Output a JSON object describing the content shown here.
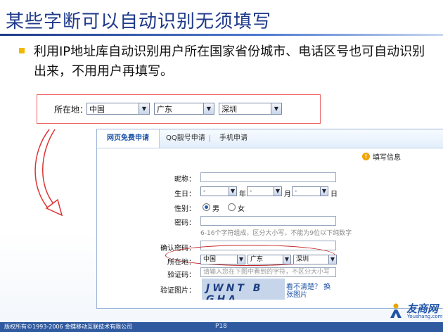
{
  "slide": {
    "title": "某些字断可以自动识别无须填写",
    "bullet": "利用IP地址库自动识别用户所在国家省份城市、电话区号也可自动识别出来，不用用户再填写。"
  },
  "region_box": {
    "label": "所在地：",
    "country": "中国",
    "province": "广东",
    "city": "深圳"
  },
  "form": {
    "tabs": [
      "网页免费申请",
      "QQ靓号申请",
      "手机申请"
    ],
    "info_label": "填写信息",
    "nickname_label": "昵称：",
    "birthday_label": "生日：",
    "birthday_year": "-",
    "birthday_year_unit": "年",
    "birthday_month": "-",
    "birthday_month_unit": "月",
    "birthday_day": "-",
    "birthday_day_unit": "日",
    "gender_label": "性别：",
    "gender_male": "男",
    "gender_female": "女",
    "password_label": "密码：",
    "password_hint": "6-16个字符组成，区分大小写，不能为9位以下纯数字",
    "confirm_label": "确认密码：",
    "location_label": "所在地：",
    "location_country": "中国",
    "location_province": "广东",
    "location_city": "深圳",
    "captcha_label": "验证码：",
    "captcha_placeholder": "请输入您在下图中看到的字符，不区分大小写",
    "captcha_image_label": "验证图片：",
    "captcha_image_text": "JWNT B GHA",
    "refresh_link": "看不清楚？ 换张图片"
  },
  "footer": {
    "copyright": "版权所有©1993-2006 金蝶移动互联技术有限公司",
    "page": "P18"
  },
  "logo": {
    "name": "友商网",
    "url": "Youshang.com"
  },
  "colors": {
    "title": "#1f3a8a",
    "bullet": "#f2b800",
    "highlight": "#c62828",
    "footer": "#2f5aa0"
  }
}
